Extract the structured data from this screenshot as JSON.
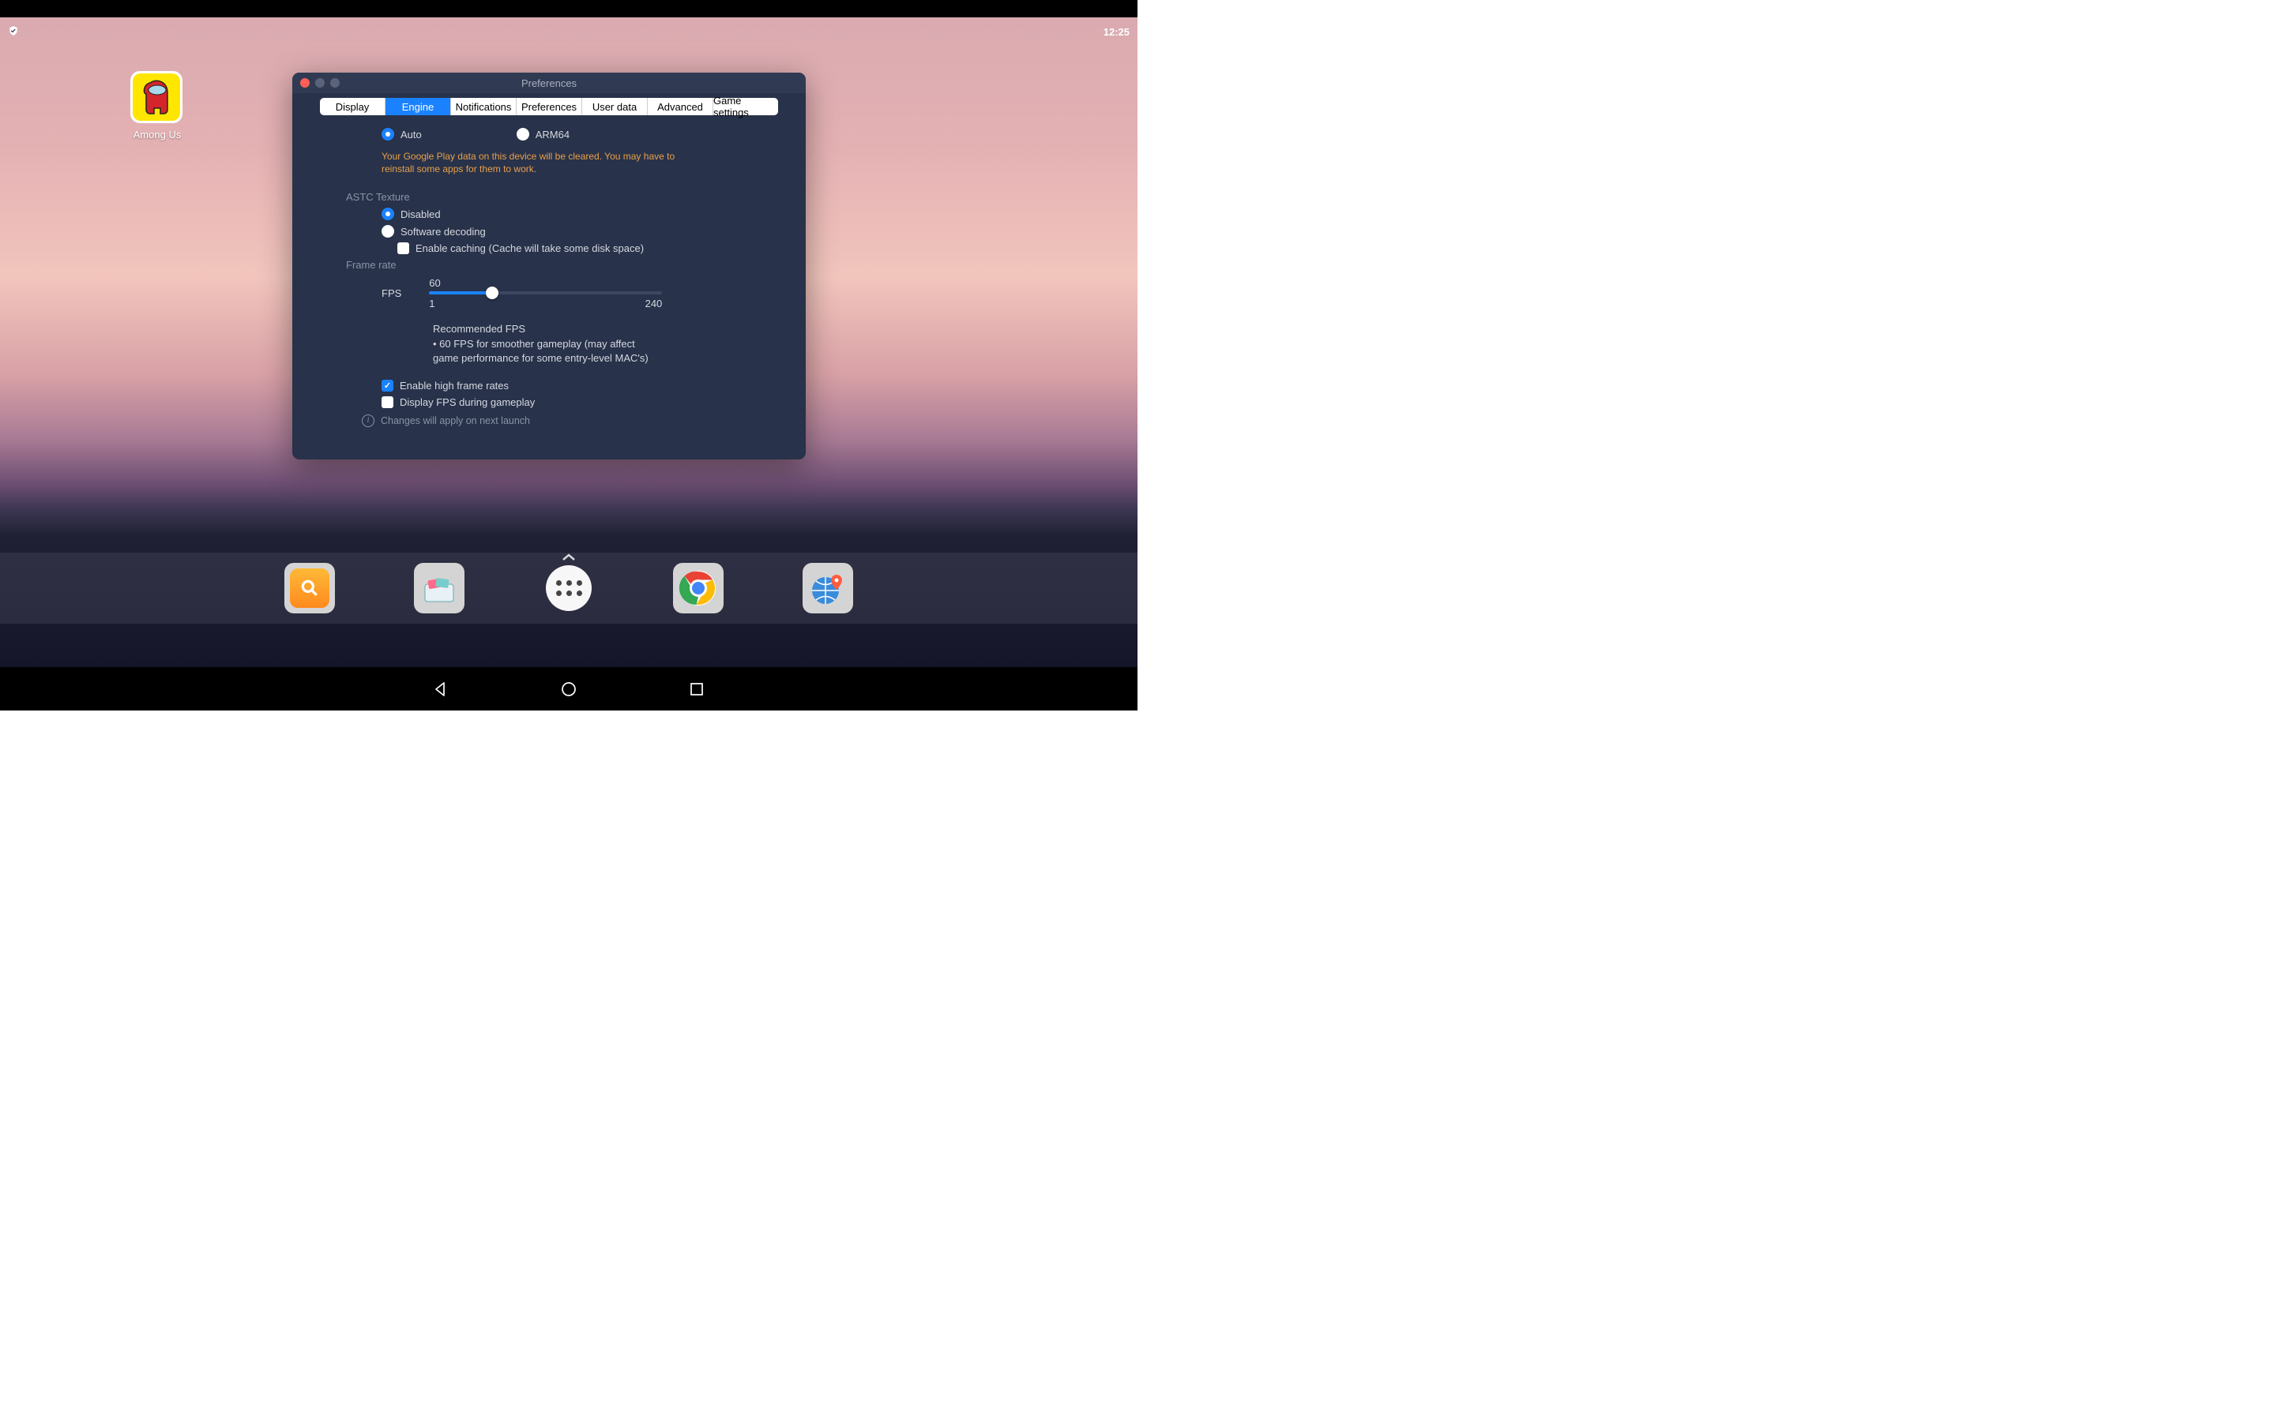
{
  "status": {
    "time": "12:25"
  },
  "desktop": {
    "apps": [
      {
        "label": "Among Us"
      }
    ]
  },
  "preferences": {
    "title": "Preferences",
    "tabs": [
      {
        "label": "Display",
        "active": false
      },
      {
        "label": "Engine",
        "active": true
      },
      {
        "label": "Notifications",
        "active": false
      },
      {
        "label": "Preferences",
        "active": false
      },
      {
        "label": "User data",
        "active": false
      },
      {
        "label": "Advanced",
        "active": false
      },
      {
        "label": "Game settings",
        "active": false
      }
    ],
    "arch": {
      "options": [
        {
          "label": "Auto",
          "selected": true
        },
        {
          "label": "ARM64",
          "selected": false
        }
      ],
      "warning": "Your Google Play data on this device will be cleared. You may have to reinstall some apps for them to work."
    },
    "astc": {
      "heading": "ASTC Texture",
      "options": [
        {
          "label": "Disabled",
          "selected": true
        },
        {
          "label": "Software decoding",
          "selected": false
        }
      ],
      "caching": {
        "label": "Enable caching (Cache will take some disk space)",
        "checked": false
      }
    },
    "framerate": {
      "heading": "Frame rate",
      "fps_label": "FPS",
      "value": "60",
      "min": "1",
      "max": "240",
      "rec_title": "Recommended FPS",
      "rec_body": "• 60 FPS for smoother gameplay (may affect game performance for some entry-level MAC's)"
    },
    "high_fps": {
      "label": "Enable high frame rates",
      "checked": true
    },
    "display_fps": {
      "label": "Display FPS during gameplay",
      "checked": false
    },
    "footer_note": "Changes will apply on next launch"
  },
  "dock": {
    "apps": [
      "search",
      "installer",
      "all-apps",
      "chrome",
      "maps"
    ]
  }
}
